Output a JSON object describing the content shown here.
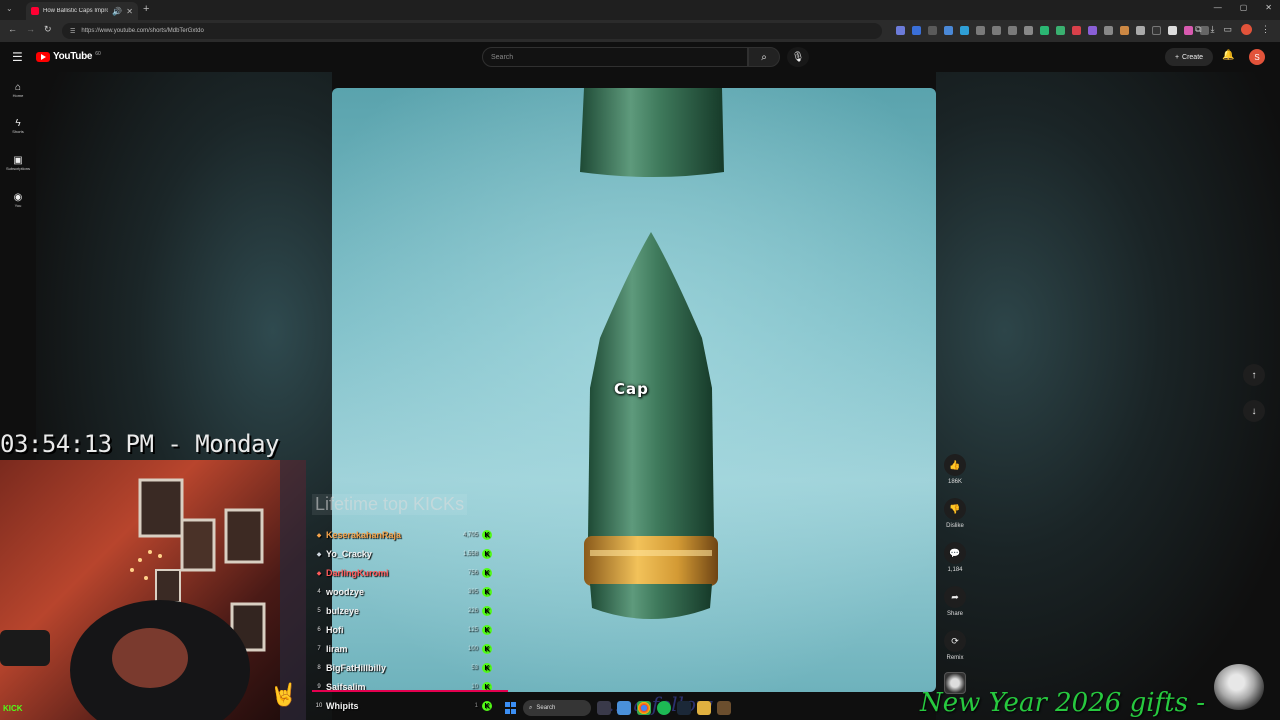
{
  "browser": {
    "tab_title": "How Ballistic Caps Improv",
    "url": "https://www.youtube.com/shorts/MdbTerGxtdo"
  },
  "youtube": {
    "logo_text": "YouTube",
    "logo_sup": "60",
    "search_placeholder": "Search",
    "create_label": "Create",
    "avatar_letter": "S",
    "nav": [
      {
        "label": "Home",
        "icon": "home-icon"
      },
      {
        "label": "Shorts",
        "icon": "shorts-icon"
      },
      {
        "label": "Subscriptions",
        "icon": "subscriptions-icon"
      },
      {
        "label": "You",
        "icon": "you-icon"
      }
    ],
    "video": {
      "caption": "Cap"
    },
    "actions": {
      "likes": "186K",
      "dislike_label": "Dislike",
      "comments": "1,184",
      "share_label": "Share",
      "remix_label": "Remix"
    }
  },
  "stream_overlay": {
    "clock": "03:54:13 PM - Monday",
    "kick_logo": "KICK",
    "toplist_title": "Lifetime top KICKs",
    "toplist": [
      {
        "rank": "",
        "name": "KeserakahanRaja",
        "value": "4,705",
        "color": "#f5a34a"
      },
      {
        "rank": "",
        "name": "Yo_Cracky",
        "value": "1,558",
        "color": "#f2f2f2"
      },
      {
        "rank": "",
        "name": "DarlingKuromi",
        "value": "756",
        "color": "#ff5a5a"
      },
      {
        "rank": "4",
        "name": "woodzye",
        "value": "395",
        "color": "#f2f2f2"
      },
      {
        "rank": "5",
        "name": "bulzeye",
        "value": "226",
        "color": "#f2f2f2"
      },
      {
        "rank": "6",
        "name": "Hofi",
        "value": "125",
        "color": "#f2f2f2"
      },
      {
        "rank": "7",
        "name": "liram",
        "value": "100",
        "color": "#f2f2f2"
      },
      {
        "rank": "8",
        "name": "BigFatHillbilly",
        "value": "53",
        "color": "#f2f2f2"
      },
      {
        "rank": "9",
        "name": "Saifsalim",
        "value": "10",
        "color": "#f2f2f2"
      },
      {
        "rank": "10",
        "name": "Whipits",
        "value": "1",
        "color": "#f2f2f2"
      }
    ],
    "gift_banner": "New Year 2026 gifts -",
    "follow_banner": "... a follow"
  },
  "taskbar": {
    "search_label": "Search"
  },
  "colors": {
    "kick_green": "#53fc18",
    "youtube_red": "#ff0000",
    "video_bg": "#7fbfc8",
    "bullet_green": "#2f6a4c",
    "bullet_gold": "#d8a23a"
  }
}
